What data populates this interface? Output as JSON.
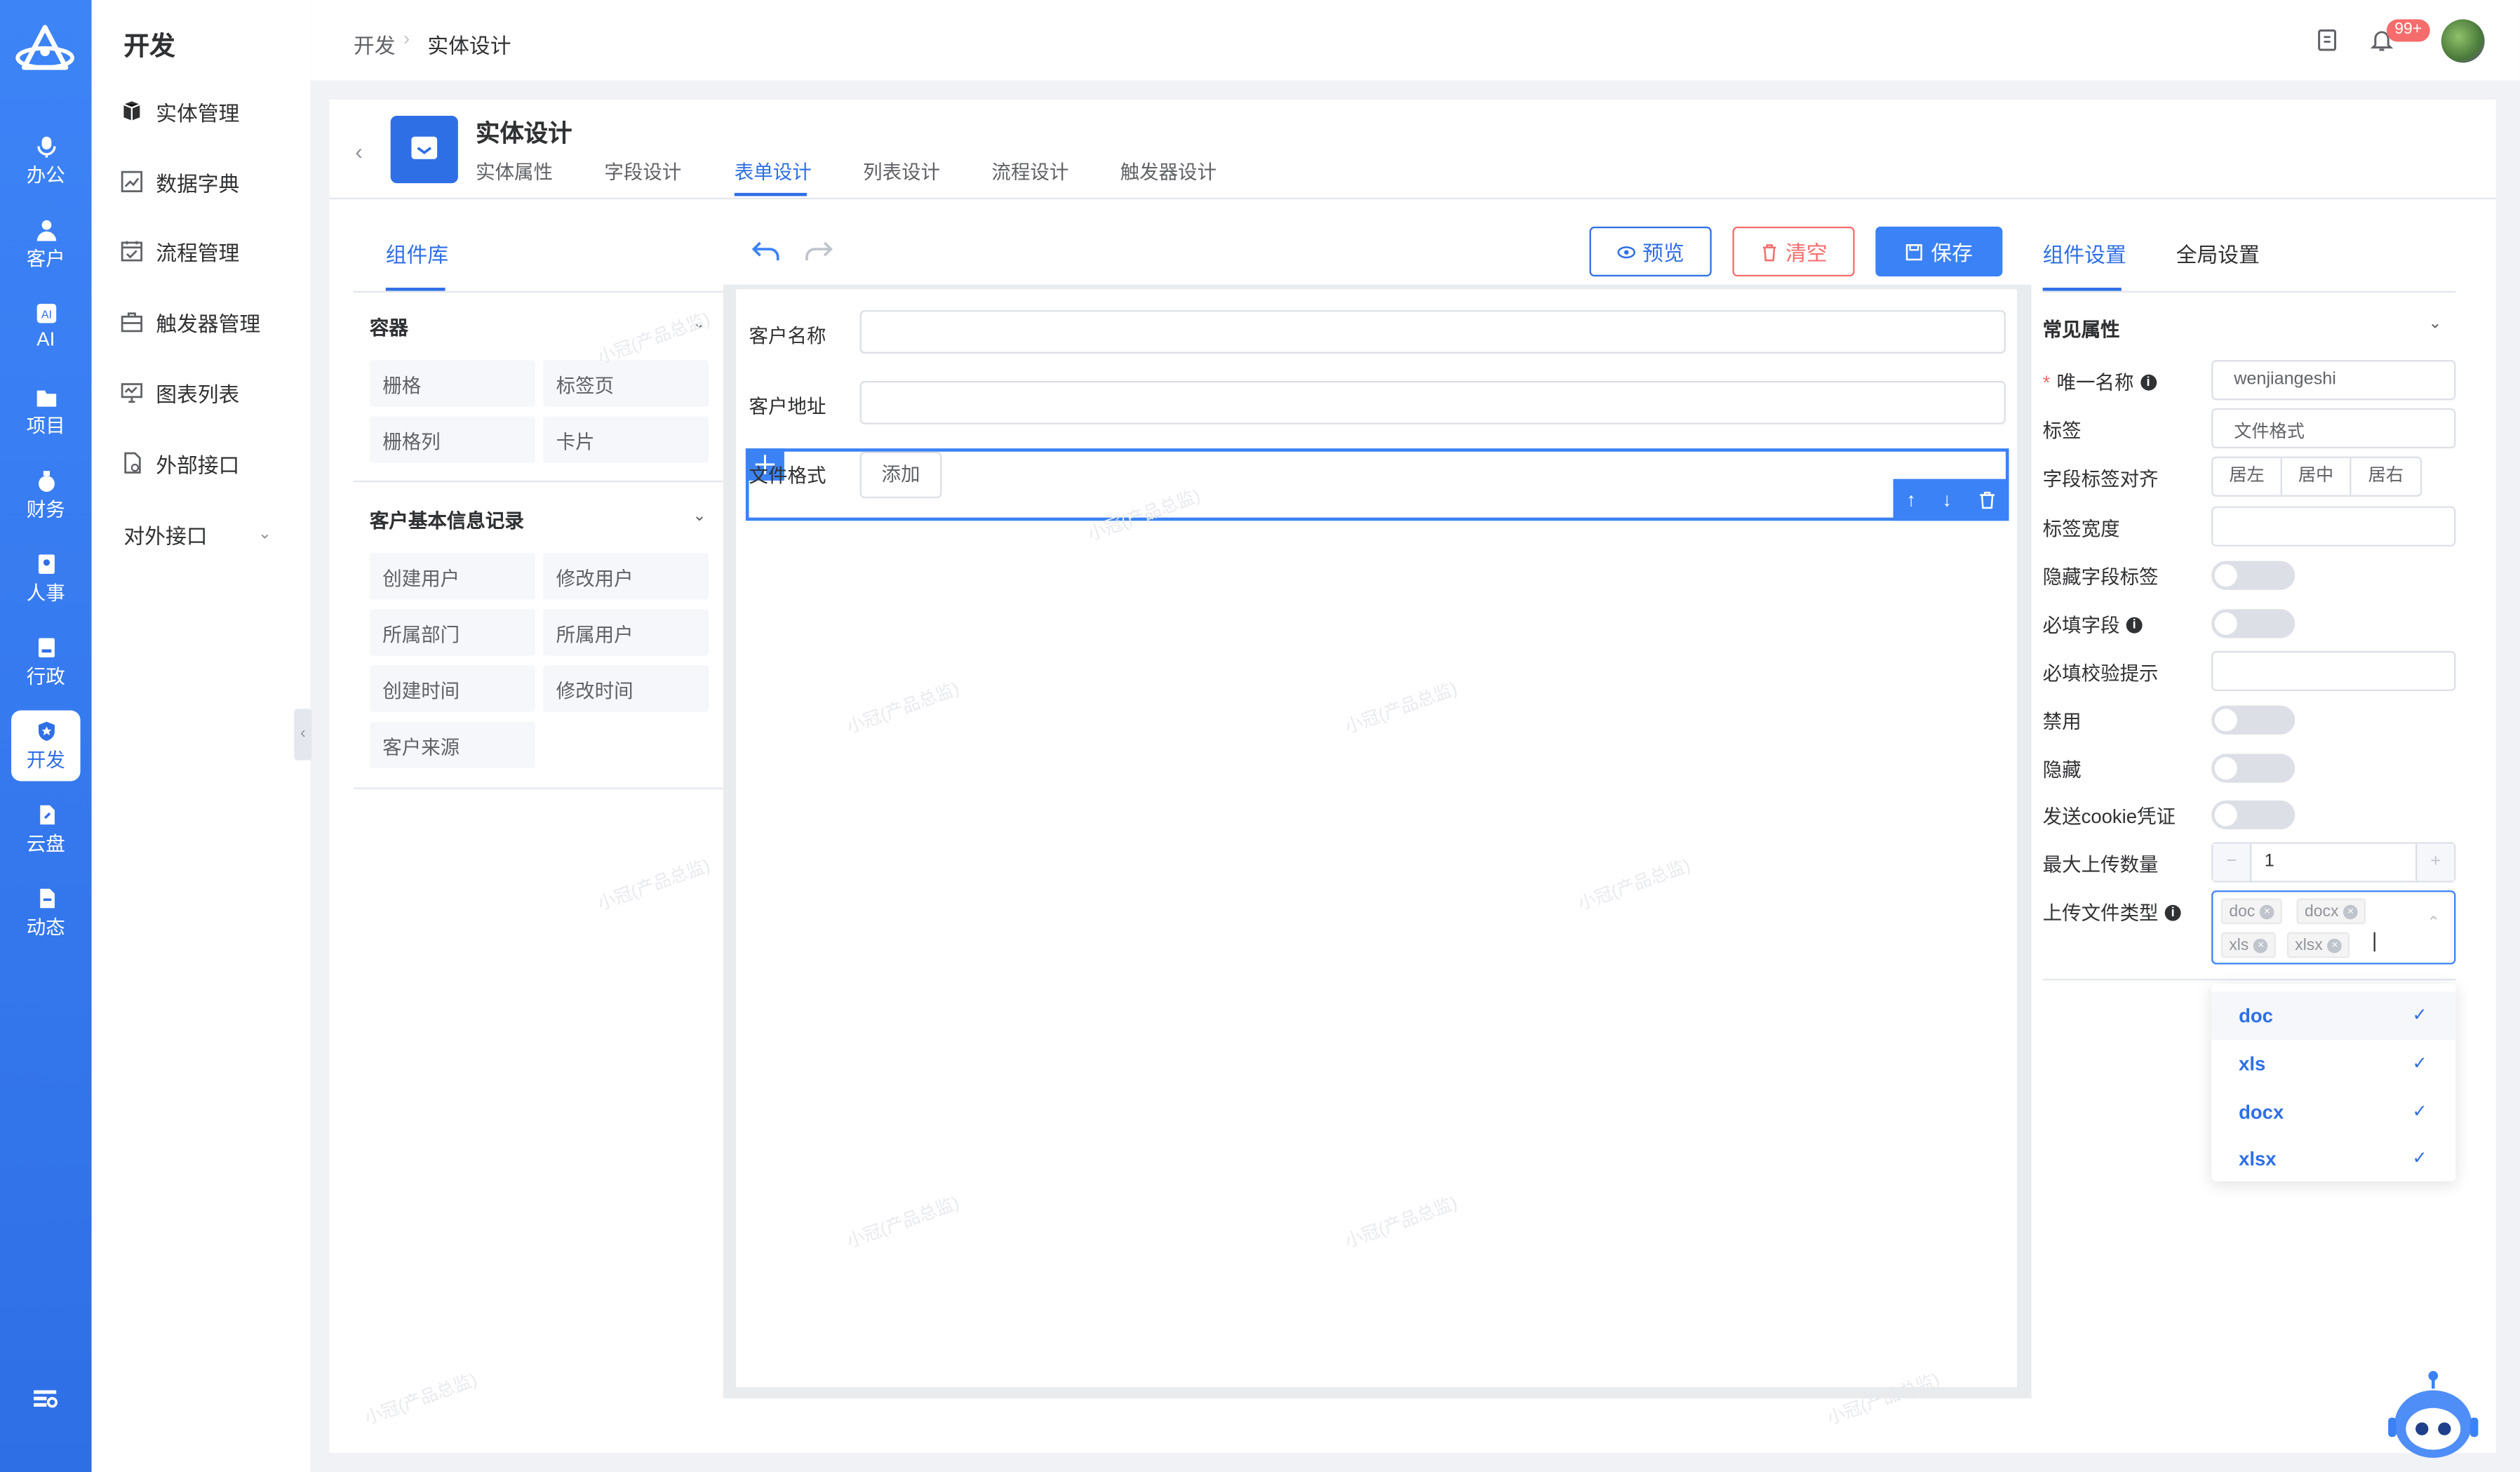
{
  "rail": {
    "items": [
      {
        "label": "办公",
        "icon": "mic-icon"
      },
      {
        "label": "客户",
        "icon": "user-icon"
      },
      {
        "label": "AI",
        "icon": "ai-icon"
      },
      {
        "label": "项目",
        "icon": "folder-icon"
      },
      {
        "label": "财务",
        "icon": "money-bag-icon"
      },
      {
        "label": "人事",
        "icon": "badge-icon"
      },
      {
        "label": "行政",
        "icon": "id-card-icon"
      },
      {
        "label": "开发",
        "icon": "shield-icon"
      },
      {
        "label": "云盘",
        "icon": "cloud-file-icon"
      },
      {
        "label": "动态",
        "icon": "document-icon"
      }
    ],
    "active": "开发"
  },
  "sidebar": {
    "title": "开发",
    "items": [
      {
        "label": "实体管理",
        "icon": "entity-icon"
      },
      {
        "label": "数据字典",
        "icon": "chart-icon"
      },
      {
        "label": "流程管理",
        "icon": "calendar-icon"
      },
      {
        "label": "触发器管理",
        "icon": "briefcase-icon"
      },
      {
        "label": "图表列表",
        "icon": "monitor-icon"
      },
      {
        "label": "外部接口",
        "icon": "file-icon"
      }
    ],
    "group": "对外接口"
  },
  "topbar": {
    "breadcrumb": [
      "开发",
      "实体设计"
    ],
    "badge": "99+"
  },
  "header": {
    "title": "实体设计",
    "tabs": [
      "实体属性",
      "字段设计",
      "表单设计",
      "列表设计",
      "流程设计",
      "触发器设计"
    ],
    "active_tab": "表单设计"
  },
  "library": {
    "tab": "组件库",
    "groups": [
      {
        "title": "容器",
        "items": [
          "栅格",
          "标签页",
          "栅格列",
          "卡片"
        ]
      },
      {
        "title": "客户基本信息记录",
        "items": [
          "创建用户",
          "修改用户",
          "所属部门",
          "所属用户",
          "创建时间",
          "修改时间",
          "客户来源"
        ]
      }
    ]
  },
  "toolbar": {
    "preview": "预览",
    "clear": "清空",
    "save": "保存"
  },
  "canvas": {
    "fields": [
      {
        "label": "客户名称"
      },
      {
        "label": "客户地址"
      },
      {
        "label": "文件格式",
        "button": "添加"
      }
    ]
  },
  "settings": {
    "tabs": [
      "组件设置",
      "全局设置"
    ],
    "group": "常见属性",
    "props": {
      "unique_name_label": "唯一名称",
      "unique_name_value": "wenjiangeshi",
      "tag_label": "标签",
      "tag_value": "文件格式",
      "align_label": "字段标签对齐",
      "align_options": [
        "居左",
        "居中",
        "居右"
      ],
      "width_label": "标签宽度",
      "hide_label_label": "隐藏字段标签",
      "required_label": "必填字段",
      "required_tip_label": "必填校验提示",
      "disabled_label": "禁用",
      "hidden_label": "隐藏",
      "cookie_label": "发送cookie凭证",
      "max_upload_label": "最大上传数量",
      "max_upload_value": "1",
      "file_types_label": "上传文件类型"
    },
    "selected_types": [
      "doc",
      "docx",
      "xls",
      "xlsx"
    ],
    "dropdown": [
      "doc",
      "xls",
      "docx",
      "xlsx"
    ]
  },
  "watermark": "小冠(产品总监)"
}
